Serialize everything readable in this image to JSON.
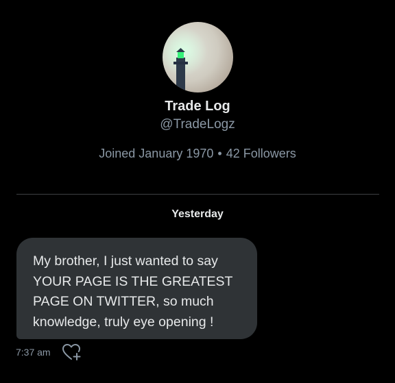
{
  "profile": {
    "display_name": "Trade Log",
    "handle": "@TradeLogz",
    "joined": "Joined January 1970",
    "separator": "•",
    "followers": "42 Followers",
    "avatar_icon": "lighthouse-in-fog-avatar"
  },
  "conversation": {
    "date_separator": "Yesterday",
    "messages": [
      {
        "text": "My brother, I just wanted to say\nYOUR PAGE IS THE GREATEST\nPAGE ON TWITTER, so much\nknowledge, truly eye opening !",
        "time": "7:37 am",
        "reaction_icon": "heart-plus-icon"
      }
    ]
  },
  "colors": {
    "background": "#000000",
    "bubble": "#2f3336",
    "primary_text": "#e7e9ea",
    "secondary_text": "#8b98a5",
    "divider": "#3e4144"
  }
}
